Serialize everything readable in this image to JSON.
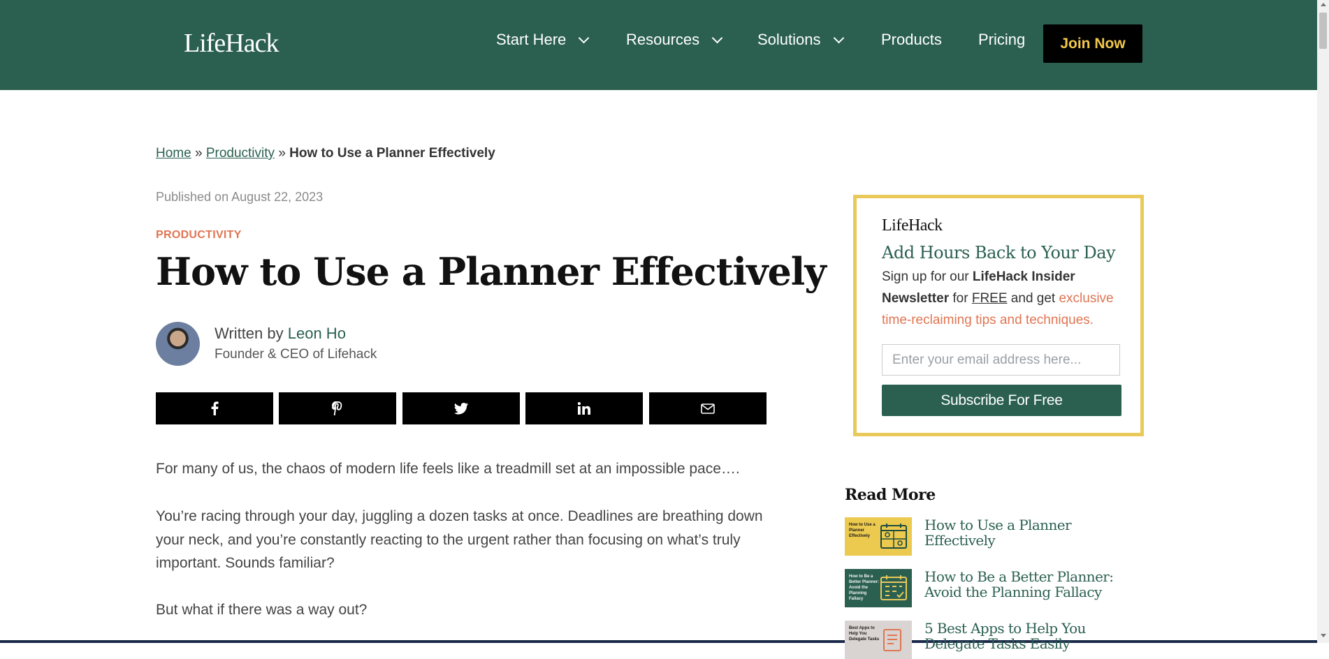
{
  "header": {
    "logo": "LifeHack",
    "nav": [
      {
        "label": "Start Here",
        "dropdown": true
      },
      {
        "label": "Resources",
        "dropdown": true
      },
      {
        "label": "Solutions",
        "dropdown": true
      },
      {
        "label": "Products",
        "dropdown": false
      },
      {
        "label": "Pricing",
        "dropdown": false
      }
    ],
    "cta": "Join Now"
  },
  "breadcrumb": {
    "home": "Home",
    "sep": "»",
    "category": "Productivity",
    "current": "How to Use a Planner Effectively"
  },
  "article": {
    "published": "Published on August 22, 2023",
    "category": "PRODUCTIVITY",
    "title": "How to Use a Planner Effectively",
    "written_by": "Written by",
    "author": "Leon Ho",
    "author_role": "Founder & CEO of Lifehack",
    "share_icons": [
      "facebook-icon",
      "pinterest-icon",
      "twitter-icon",
      "linkedin-icon",
      "email-icon"
    ],
    "paragraphs": [
      "For many of us, the chaos of modern life feels like a treadmill set at an impossible pace….",
      "You’re racing through your day, juggling a dozen tasks at once. Deadlines are breathing down your neck, and you’re constantly reacting to the urgent rather than focusing on what’s truly important. Sounds familiar?",
      "But what if there was a way out?"
    ]
  },
  "newsletter": {
    "logo": "LifeHack",
    "heading": "Add Hours Back to Your Day",
    "body_pre": "Sign up for our ",
    "body_bold": "LifeHack Insider Newsletter",
    "body_mid": " for ",
    "body_free": "FREE",
    "body_and": " and get ",
    "body_accent": "exclusive time-reclaiming tips and techniques.",
    "email_placeholder": "Enter your email address here...",
    "button": "Subscribe For Free"
  },
  "read_more": {
    "heading": "Read More",
    "items": [
      {
        "title": "How to Use a Planner Effectively",
        "thumb_text": "How to Use a Planner Effectively"
      },
      {
        "title": "How to Be a Better Planner: Avoid the Planning Fallacy",
        "thumb_text": "How to Be a Better Planner: Avoid the Planning Fallacy"
      },
      {
        "title": "5 Best Apps to Help You Delegate Tasks Easily",
        "thumb_text": "Best Apps to Help You Delegate Tasks"
      }
    ]
  },
  "colors": {
    "brand_green": "#2b6051",
    "accent_orange": "#e07552",
    "cta_yellow": "#f1c84b",
    "border_gold": "#e8c95a"
  }
}
